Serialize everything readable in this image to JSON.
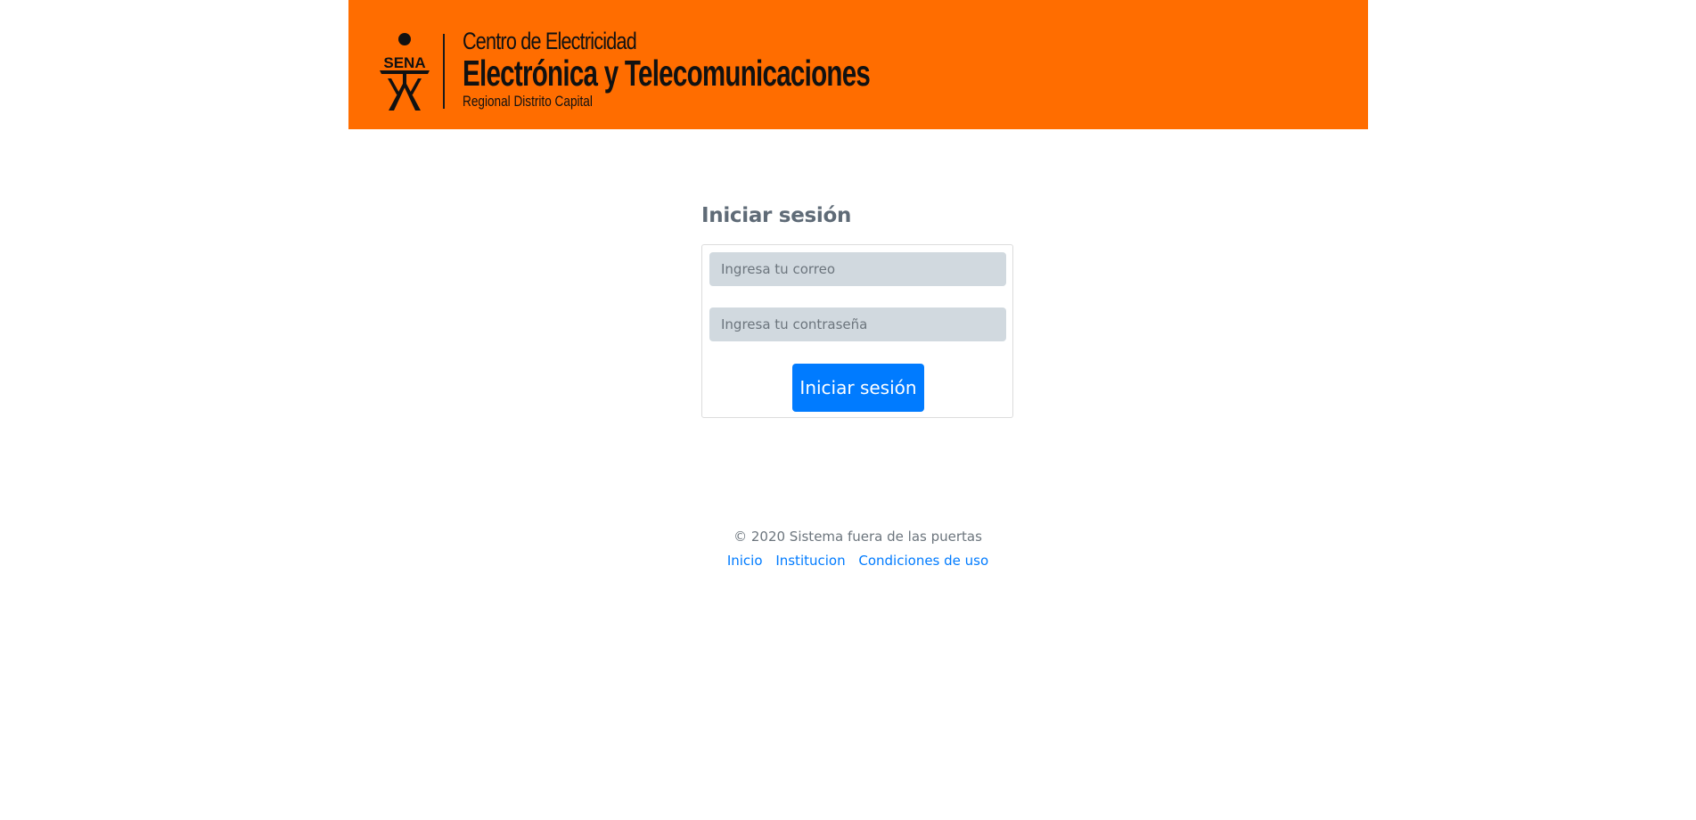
{
  "banner": {
    "background_color": "#ff6d00",
    "logo": {
      "icon": "sena-logo-icon",
      "text": "SENA"
    },
    "line1": "Centro de Electricidad",
    "line2": "Electrónica y Telecomunicaciones",
    "line3": "Regional Distrito Capital"
  },
  "login": {
    "title": "Iniciar sesión",
    "email_placeholder": "Ingresa tu correo",
    "email_value": "",
    "password_placeholder": "Ingresa tu contraseña",
    "password_value": "",
    "submit_label": "Iniciar sesión",
    "button_color": "#007bff"
  },
  "footer": {
    "copyright": "© 2020 Sistema fuera de las puertas",
    "links": [
      {
        "label": "Inicio"
      },
      {
        "label": "Institucion"
      },
      {
        "label": "Condiciones de uso"
      }
    ],
    "link_color": "#007bff"
  }
}
